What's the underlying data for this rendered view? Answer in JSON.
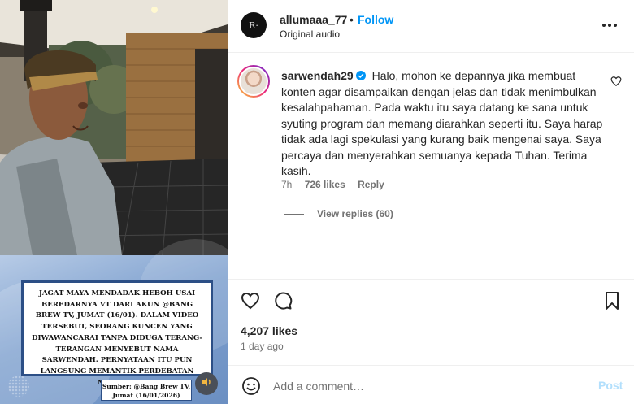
{
  "post": {
    "author": "allumaaa_77",
    "separator": "•",
    "follow_label": "Follow",
    "audio": "Original audio"
  },
  "media": {
    "news_text": "JAGAT MAYA MENDADAK HEBOH USAI BEREDARNYA VT DARI AKUN @BANG BREW TV, JUMAT (16/01). DALAM VIDEO TERSEBUT, SEORANG KUNCEN YANG DIWAWANCARAI TANPA DIDUGA TERANG-TERANGAN MENYEBUT NAMA SARWENDAH. PERNYATAAN ITU PUN LANGSUNG MEMANTIK PERDEBATAN NETIZEN.",
    "source_line1": "Sumber: @Bang Brew TV,",
    "source_line2": "Jumat (16/01/2026)"
  },
  "comment": {
    "user": "sarwendah29",
    "text": "Halo, mohon ke depannya jika membuat konten agar disampaikan dengan jelas dan tidak menimbulkan kesalahpahaman. Pada waktu itu saya datang ke sana untuk syuting program dan memang diarahkan seperti itu. Saya harap tidak ada lagi spekulasi yang kurang baik mengenai saya. Saya percaya dan menyerahkan semuanya kepada Tuhan. Terima kasih.",
    "age": "7h",
    "likes": "726 likes",
    "reply_label": "Reply",
    "view_replies": "View replies (60)"
  },
  "actions": {
    "likes": "4,207 likes",
    "time": "1 day ago"
  },
  "composer": {
    "placeholder": "Add a comment…",
    "post_label": "Post"
  },
  "colors": {
    "accent": "#0095f6",
    "post_disabled": "#b2dffc",
    "verified": "#0095f6",
    "muted": "#737373"
  },
  "icons": [
    "more-icon",
    "verified-icon",
    "heart-icon",
    "comment-icon",
    "bookmark-icon",
    "emoji-icon",
    "speaker-icon"
  ]
}
